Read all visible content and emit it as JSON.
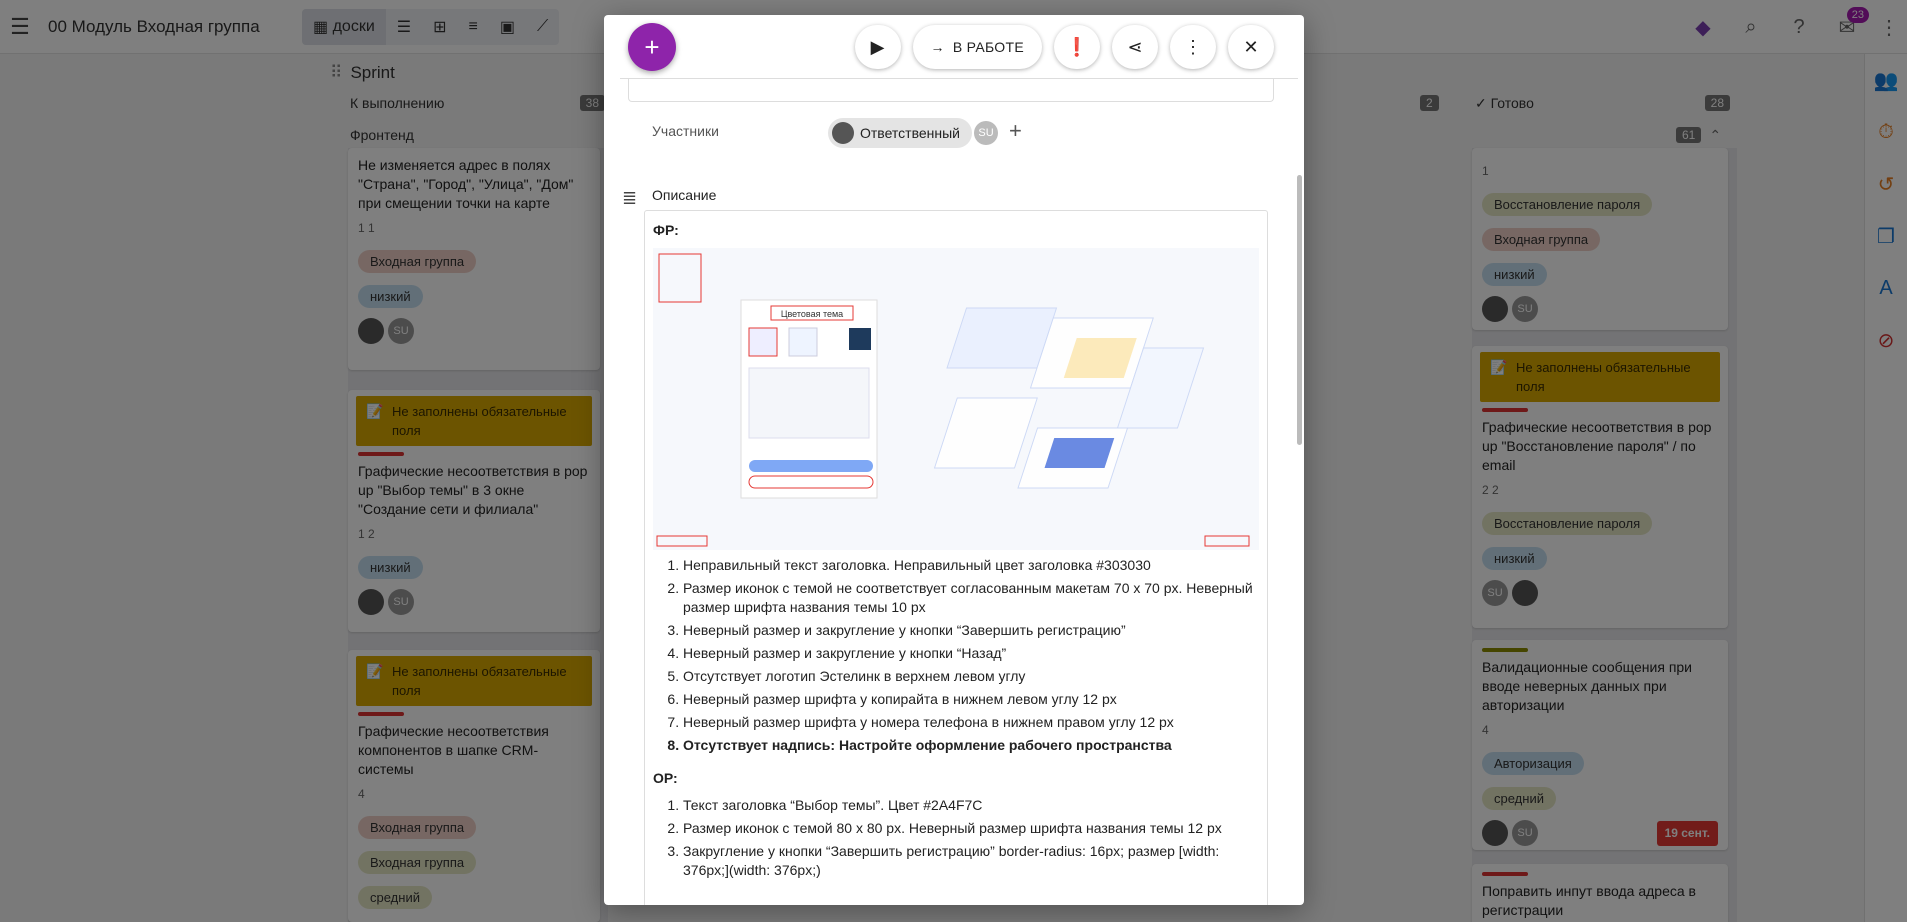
{
  "topbar": {
    "project_title": "00 Модуль Входная группа",
    "view_boards_label": "доски",
    "notifications_count": "23"
  },
  "board": {
    "sprint_title": "Sprint",
    "columns": [
      {
        "title": "К выполнению",
        "count": "38",
        "swimlane": "Фронтенд"
      },
      {
        "title": "",
        "count": "2"
      },
      {
        "title": "Готово",
        "count": "28",
        "swimlane_count": "61"
      }
    ],
    "left_cards": [
      {
        "title": "Не изменяется адрес в полях \"Страна\", \"Город\", \"Улица\", \"Дом\" при смещении точки на карте",
        "meta": "1  1",
        "tags": [
          "Входная группа",
          "низкий"
        ]
      },
      {
        "warning": "Не заполнены обязательные поля",
        "title": "Графические несоответствия в pop up \"Выбор темы\" в 3 окне \"Создание сети и филиала\"",
        "meta": "1  2",
        "tags": [
          "низкий"
        ]
      },
      {
        "warning": "Не заполнены обязательные поля",
        "title": "Графические несоответствия компонентов в шапке CRM-системы",
        "meta": "4",
        "tags": [
          "Входная группа",
          "Входная группа",
          "средний"
        ]
      }
    ],
    "right_cards": [
      {
        "meta": "1",
        "tags": [
          "Восстановление пароля",
          "Входная группа",
          "низкий"
        ]
      },
      {
        "warning": "Не заполнены обязательные поля",
        "title": "Графические несоответствия в pop up \"Восстановление пароля\" / по email",
        "meta": "2  2",
        "tags": [
          "Восстановление пароля",
          "низкий"
        ]
      },
      {
        "title": "Валидационные сообщения при вводе неверных данных при авторизации",
        "meta": "4",
        "tags": [
          "Авторизация",
          "средний"
        ],
        "due": "19 сент."
      },
      {
        "title": "Поправить инпут ввода адреса в регистрации"
      }
    ]
  },
  "modal": {
    "status_label": "В РАБОТЕ",
    "participants_label": "Участники",
    "assignee_chip": "Ответственный",
    "avatar_initials": "SU",
    "description_label": "Описание",
    "fr_label": "ФР:",
    "or_label": "ОР:",
    "embedded_screenshot_title": "Цветовая тема",
    "fr_items": [
      "Неправильный текст заголовка. Неправильный цвет заголовка #303030",
      "Размер иконок с темой не соответствует согласованным макетам 70 х 70 px. Неверный размер шрифта названия темы 10 px",
      "Неверный размер и закругление у кнопки “Завершить регистрацию”",
      "Неверный размер и закругление у кнопки “Назад”",
      "Отсутствует логотип Эстелинк в верхнем левом углу",
      "Неверный размер шрифта у копирайта в нижнем левом углу 12 px",
      "Неверный размер шрифта у номера телефона в нижнем правом углу 12 px",
      "Отсутствует надпись: Настройте оформление рабочего пространства"
    ],
    "or_items": [
      "Текст заголовка “Выбор темы”. Цвет #2A4F7C",
      "Размер иконок с темой 80 х 80 px. Неверный размер шрифта названия темы 12 px",
      "Закругление у кнопки “Завершить регистрацию” border-radius: 16px; размер [width: 376px;](width: 376px;)"
    ]
  },
  "colors": {
    "accent": "#8e24aa",
    "warning": "#d9a900",
    "label_red": "#eecfc6",
    "label_blue": "#c4dff0"
  }
}
